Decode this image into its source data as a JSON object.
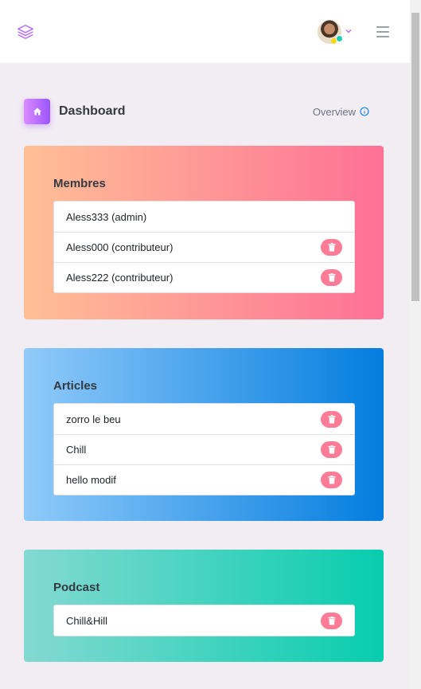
{
  "navbar": {
    "logo_icon": "layers-icon",
    "avatar_icon": "user-avatar",
    "menu_icon": "hamburger-icon"
  },
  "page": {
    "title": "Dashboard",
    "overview_label": "Overview",
    "home_icon": "home-icon",
    "info_icon": "info-circle-icon"
  },
  "colors": {
    "accent": "#9a55ff",
    "danger_gradient": [
      "#ffbf96",
      "#fe7096"
    ],
    "info_gradient": [
      "#90caf9",
      "#047edf"
    ],
    "success_gradient": [
      "#84d9d2",
      "#07cdae"
    ],
    "delete_button": "#fe7c96"
  },
  "membres": {
    "title": "Membres",
    "items": [
      {
        "label": "Aless333 (admin)"
      },
      {
        "label": "Aless000 (contributeur)"
      },
      {
        "label": "Aless222 (contributeur)"
      }
    ]
  },
  "articles": {
    "title": "Articles",
    "items": [
      {
        "label": "zorro le beu"
      },
      {
        "label": "Chill"
      },
      {
        "label": "hello modif"
      }
    ]
  },
  "podcast": {
    "title": "Podcast",
    "items": [
      {
        "label": "Chill&Hill"
      }
    ]
  }
}
